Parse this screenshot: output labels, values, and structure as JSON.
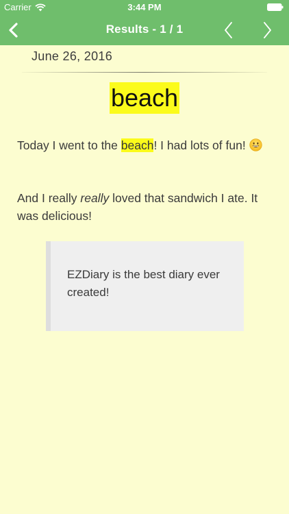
{
  "status_bar": {
    "carrier": "Carrier",
    "time": "3:44 PM"
  },
  "nav": {
    "title": "Results - 1 / 1",
    "back_icon": "chevron-left-icon",
    "prev_icon": "chevron-left-icon",
    "next_icon": "chevron-right-icon"
  },
  "entry": {
    "date": "June 26, 2016",
    "search_term": "beach",
    "paragraph1": {
      "before": "Today I went to the ",
      "highlight": "beach",
      "after": "! I had lots of fun! ",
      "emoji": "smiley-emoji-icon"
    },
    "paragraph2": {
      "before": "And I really ",
      "emphasis": "really",
      "after": " loved that sandwich I ate. It was delicious!"
    },
    "quote": "EZDiary is the best diary ever created!"
  },
  "colors": {
    "nav_bar": "#6fbe6c",
    "background": "#fcfdd0",
    "highlight": "#fbfb1b",
    "quote_bg": "#efefef"
  }
}
